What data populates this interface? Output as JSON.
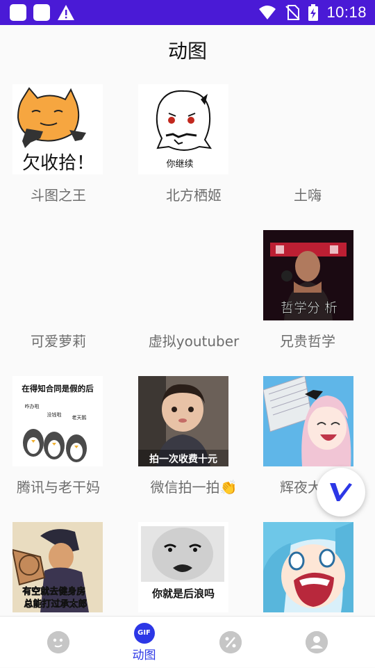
{
  "status_bar": {
    "time": "10:18"
  },
  "header": {
    "title": "动图"
  },
  "items": [
    {
      "label": "斗图之王",
      "caption": "欠收拾！"
    },
    {
      "label": "北方栖姬",
      "caption": "你继续"
    },
    {
      "label": "土嗨",
      "caption": ""
    },
    {
      "label": "可爱萝莉",
      "caption": ""
    },
    {
      "label": "虚拟youtuber",
      "caption": ""
    },
    {
      "label": "兄贵哲学",
      "caption": "哲学分 析"
    },
    {
      "label": "腾讯与老干妈",
      "caption": "在得知合同是假的后"
    },
    {
      "label": "微信拍一拍👏",
      "caption": "拍一次收费十元"
    },
    {
      "label": "辉夜大小",
      "caption": ""
    },
    {
      "label": "",
      "caption": "有空就去健身房 总能打过承太郎"
    },
    {
      "label": "",
      "caption": "你就是后浪吗"
    },
    {
      "label": "",
      "caption": ""
    }
  ],
  "penguins": [
    "咋办啦",
    "没钱啦",
    "老天鹅"
  ],
  "tabbar": {
    "active_label": "动图",
    "gif_badge": "GIF"
  }
}
